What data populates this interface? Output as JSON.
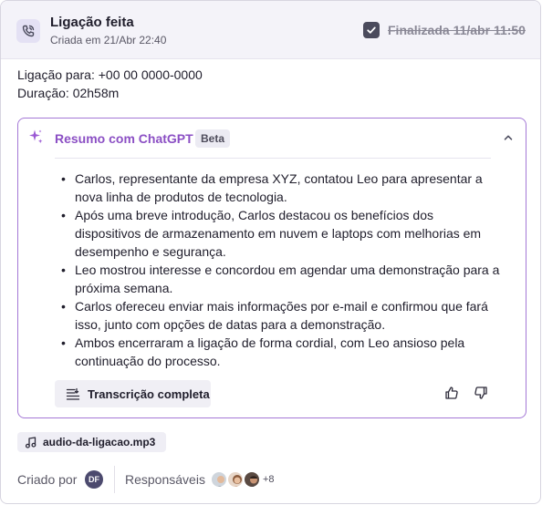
{
  "header": {
    "title": "Ligação feita",
    "subtitle": "Criada em 21/Abr 22:40",
    "status_label": "Finalizada 11/abr 11:50",
    "status_checked": true,
    "icon": "phone-call-icon"
  },
  "call": {
    "to_line": "Ligação para: +00 00 0000-0000",
    "duration_line": "Duração: 02h58m"
  },
  "summary": {
    "title": "Resumo com ChatGPT",
    "badge": "Beta",
    "bullets": [
      "Carlos, representante da empresa XYZ, contatou Leo para apresentar a nova linha de produtos de tecnologia.",
      "Após uma breve introdução, Carlos destacou os benefícios dos dispositivos de armazenamento em nuvem e laptops com melhorias em desempenho e segurança.",
      "Leo mostrou interesse e concordou em agendar uma demonstração para a próxima semana.",
      "Carlos ofereceu enviar mais informações por e-mail e confirmou que fará isso, junto com opções de datas para a demonstração.",
      "Ambos encerraram a ligação de forma cordial, com Leo ansioso pela continuação do processo."
    ],
    "transcript_button": "Transcrição completa",
    "accent_color": "#a478d6"
  },
  "attachment": {
    "filename": "audio-da-ligacao.mp3",
    "icon": "music-note-icon"
  },
  "footer": {
    "created_by_label": "Criado por",
    "creator_initials": "DF",
    "responsibles_label": "Responsáveis",
    "more_count": "+8"
  }
}
